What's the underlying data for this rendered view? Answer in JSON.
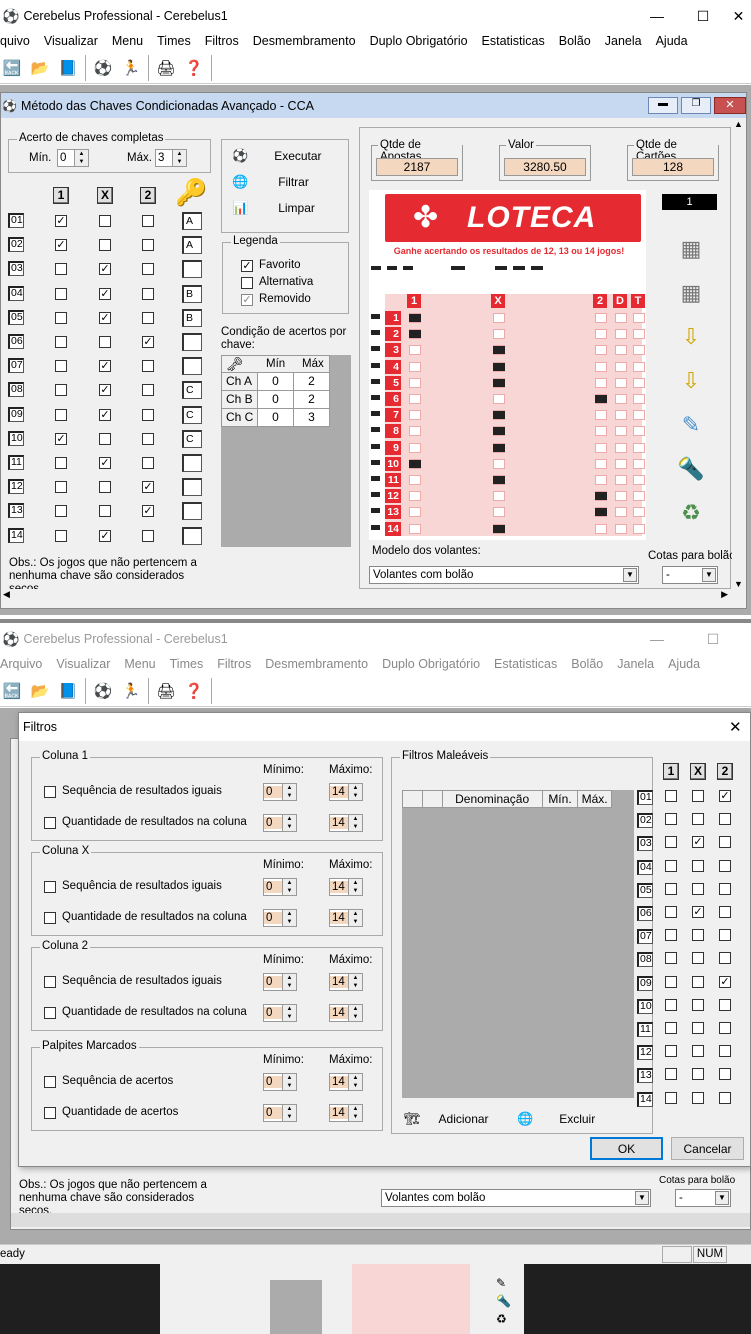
{
  "app": {
    "title": "Cerebelus Professional - Cerebelus1",
    "menu": [
      "quivo",
      "Visualizar",
      "Menu",
      "Times",
      "Filtros",
      "Desmembramento",
      "Duplo Obrigatório",
      "Estatisticas",
      "Bolão",
      "Janela",
      "Ajuda"
    ],
    "menu2": [
      "Arquivo",
      "Visualizar",
      "Menu",
      "Times",
      "Filtros",
      "Desmembramento",
      "Duplo Obrigatório",
      "Estatisticas",
      "Bolão",
      "Janela",
      "Ajuda"
    ]
  },
  "cca": {
    "title": "Método das Chaves Condicionadas Avançado - CCA",
    "acerto_group": "Acerto de chaves completas",
    "min_label": "Mín.",
    "min_value": "0",
    "max_label": "Máx.",
    "max_value": "3",
    "col_headers": [
      "1",
      "X",
      "2"
    ],
    "rows": [
      {
        "n": "01",
        "c1": true,
        "cx": false,
        "c2": false,
        "key": "A"
      },
      {
        "n": "02",
        "c1": true,
        "cx": false,
        "c2": false,
        "key": "A"
      },
      {
        "n": "03",
        "c1": false,
        "cx": true,
        "c2": false,
        "key": ""
      },
      {
        "n": "04",
        "c1": false,
        "cx": true,
        "c2": false,
        "key": "B"
      },
      {
        "n": "05",
        "c1": false,
        "cx": true,
        "c2": false,
        "key": "B"
      },
      {
        "n": "06",
        "c1": false,
        "cx": false,
        "c2": true,
        "key": ""
      },
      {
        "n": "07",
        "c1": false,
        "cx": true,
        "c2": false,
        "key": ""
      },
      {
        "n": "08",
        "c1": false,
        "cx": true,
        "c2": false,
        "key": "C"
      },
      {
        "n": "09",
        "c1": false,
        "cx": true,
        "c2": false,
        "key": "C"
      },
      {
        "n": "10",
        "c1": true,
        "cx": false,
        "c2": false,
        "key": "C"
      },
      {
        "n": "11",
        "c1": false,
        "cx": true,
        "c2": false,
        "key": ""
      },
      {
        "n": "12",
        "c1": false,
        "cx": false,
        "c2": true,
        "key": ""
      },
      {
        "n": "13",
        "c1": false,
        "cx": false,
        "c2": true,
        "key": ""
      },
      {
        "n": "14",
        "c1": false,
        "cx": true,
        "c2": false,
        "key": ""
      }
    ],
    "obs": "Obs.: Os jogos que não pertencem a nenhuma chave são considerados secos.",
    "btn_executar": "Executar",
    "btn_filtrar": "Filtrar",
    "btn_limpar": "Limpar",
    "legenda_title": "Legenda",
    "legenda": [
      "Favorito",
      "Alternativa",
      "Removido"
    ],
    "cond_title": "Condição de acertos por chave:",
    "cond_headers": [
      "Mín",
      "Máx"
    ],
    "cond_rows": [
      {
        "name": "Ch A",
        "min": "0",
        "max": "2"
      },
      {
        "name": "Ch B",
        "min": "0",
        "max": "2"
      },
      {
        "name": "Ch C",
        "min": "0",
        "max": "3"
      }
    ],
    "qtde_apostas_label": "Qtde de Apostas",
    "qtde_apostas": "2187",
    "valor_label": "Valor",
    "valor": "3280.50",
    "qtde_cartoes_label": "Qtde de Cartões",
    "qtde_cartoes": "128",
    "card_counter": "1",
    "loteca_title": "LOTECA",
    "loteca_sub": "Ganhe acertando os resultados de 12, 13 ou 14 jogos!",
    "ticket_headers": [
      "1",
      "X",
      "2",
      "D",
      "T"
    ],
    "ticket_marks": [
      "1",
      "1",
      "X",
      "X",
      "X",
      "2",
      "X",
      "X",
      "X",
      "1",
      "X",
      "2",
      "2",
      "X"
    ],
    "modelo_label": "Modelo dos volantes:",
    "modelo_value": "Volantes com bolão",
    "cotas_label": "Cotas para bolão",
    "cotas_value": "-"
  },
  "filtros": {
    "title": "Filtros",
    "min_label": "Mínimo:",
    "max_label": "Máximo:",
    "groups": [
      {
        "title": "Coluna 1",
        "rows": [
          {
            "label": "Sequência de resultados iguais",
            "min": "0",
            "max": "14"
          },
          {
            "label": "Quantidade de resultados na coluna",
            "min": "0",
            "max": "14"
          }
        ]
      },
      {
        "title": "Coluna X",
        "rows": [
          {
            "label": "Sequência de resultados iguais",
            "min": "0",
            "max": "14"
          },
          {
            "label": "Quantidade de resultados na coluna",
            "min": "0",
            "max": "14"
          }
        ]
      },
      {
        "title": "Coluna 2",
        "rows": [
          {
            "label": "Sequência de resultados iguais",
            "min": "0",
            "max": "14"
          },
          {
            "label": "Quantidade de resultados na coluna",
            "min": "0",
            "max": "14"
          }
        ]
      },
      {
        "title": "Palpites Marcados",
        "rows": [
          {
            "label": "Sequência de acertos",
            "min": "0",
            "max": "14"
          },
          {
            "label": "Quantidade de acertos",
            "min": "0",
            "max": "14"
          }
        ]
      }
    ],
    "maleaveis_title": "Filtros Maleáveis",
    "maleaveis_headers": [
      "Denominação",
      "Mín.",
      "Máx."
    ],
    "btn_adicionar": "Adicionar",
    "btn_excluir": "Excluir",
    "btn_ok": "OK",
    "btn_cancelar": "Cancelar",
    "grid_headers": [
      "1",
      "X",
      "2"
    ],
    "grid_rows": [
      {
        "n": "01",
        "c1": false,
        "cx": false,
        "c2": true
      },
      {
        "n": "02",
        "c1": false,
        "cx": false,
        "c2": false
      },
      {
        "n": "03",
        "c1": false,
        "cx": true,
        "c2": false
      },
      {
        "n": "04",
        "c1": false,
        "cx": false,
        "c2": false
      },
      {
        "n": "05",
        "c1": false,
        "cx": false,
        "c2": false
      },
      {
        "n": "06",
        "c1": false,
        "cx": true,
        "c2": false
      },
      {
        "n": "07",
        "c1": false,
        "cx": false,
        "c2": false
      },
      {
        "n": "08",
        "c1": false,
        "cx": false,
        "c2": false
      },
      {
        "n": "09",
        "c1": false,
        "cx": false,
        "c2": true
      },
      {
        "n": "10",
        "c1": false,
        "cx": false,
        "c2": false
      },
      {
        "n": "11",
        "c1": false,
        "cx": false,
        "c2": false
      },
      {
        "n": "12",
        "c1": false,
        "cx": false,
        "c2": false
      },
      {
        "n": "13",
        "c1": false,
        "cx": false,
        "c2": false
      },
      {
        "n": "14",
        "c1": false,
        "cx": false,
        "c2": false
      }
    ]
  },
  "status": {
    "left": "eady",
    "right": "NUM"
  },
  "colors": {
    "mdi_title": "#c7d9f0",
    "loteca_red": "#e52a31",
    "ticket_pink": "#f8d6d6",
    "field_bg": "#f4d7bf"
  }
}
